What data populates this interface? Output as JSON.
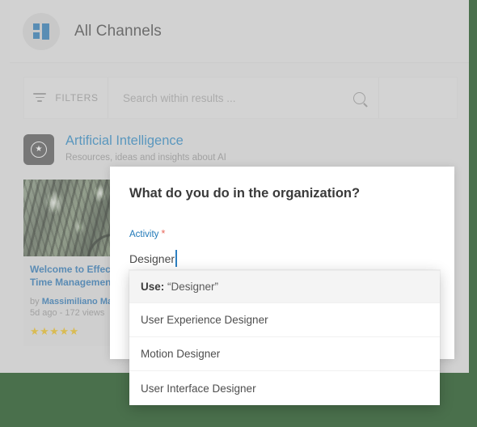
{
  "app": {
    "title": "All Channels",
    "grid_icon": "grid-icon"
  },
  "toolbar": {
    "filters_label": "FILTERS",
    "filter_icon": "filter-icon",
    "search_placeholder": "Search within results ...",
    "search_value": "",
    "search_icon": "search-icon"
  },
  "channel": {
    "name": "Artificial Intelligence",
    "description": "Resources, ideas and insights about AI",
    "icon": "star-circle-icon"
  },
  "card": {
    "title_line1": "Welcome to Effective",
    "title_line2": "Time Management",
    "by_prefix": "by",
    "author": "Massimiliano Massa",
    "meta": "5d ago - 172 views",
    "stars": "★★★★★",
    "rating": 5
  },
  "modal": {
    "title": "What do you do in the organization?",
    "field_label": "Activity",
    "required_marker": "*",
    "field_value": "Designer",
    "field_placeholder": ""
  },
  "dropdown": {
    "use_prefix": "Use:",
    "use_value": "“Designer”",
    "options": [
      "User Experience Designer",
      "Motion Designer",
      "User Interface Designer"
    ]
  },
  "colors": {
    "page_bg": "#d3d3d3",
    "backdrop_green": "#4a704c",
    "link_blue": "#1f7bb6",
    "label_blue": "#1f78b8",
    "required_red": "#e8685c",
    "star_gold": "#e0b215",
    "icon_blue": "#1d6ca8"
  }
}
